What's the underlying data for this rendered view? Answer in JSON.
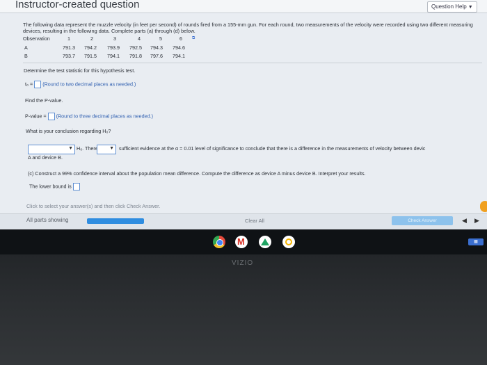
{
  "header": {
    "title": "Instructor-created question",
    "question_help": "Question Help"
  },
  "intro": "The following data represent the muzzle velocity (in feet per second) of rounds fired from a 155-mm gun. For each round, two measurements of the velocity were recorded using two different measuring devices, resulting in the following data. Complete parts (a) through (d) below.",
  "table": {
    "header_label": "Observation",
    "observations": [
      "1",
      "2",
      "3",
      "4",
      "5",
      "6"
    ],
    "rows": [
      {
        "label": "A",
        "values": [
          "791.3",
          "794.2",
          "793.9",
          "792.5",
          "794.3",
          "794.6"
        ]
      },
      {
        "label": "B",
        "values": [
          "793.7",
          "791.5",
          "794.1",
          "791.8",
          "797.6",
          "794.1"
        ]
      }
    ]
  },
  "parts": {
    "test_stat_prompt": "Determine the test statistic for this hypothesis test.",
    "t0_label": "t₀ =",
    "t0_hint": "(Round to two decimal places as needed.)",
    "pvalue_prompt": "Find the P-value.",
    "pvalue_label": "P-value =",
    "pvalue_hint": "(Round to three decimal places as needed.)",
    "conclusion_prompt": "What is your conclusion regarding H₀?",
    "h0_label": "H₀. There",
    "sentence_tail": "sufficient evidence at the α = 0.01 level of significance to conclude that there is a difference in the measurements of velocity between devic",
    "sentence_wrap": "A and device B.",
    "part_c": "(c) Construct a 99% confidence interval about the population mean difference. Compute the difference as device A minus device B. Interpret your results.",
    "lower_bound_label": "The lower bound is"
  },
  "footer": {
    "instruction": "Click to select your answer(s) and then click Check Answer.",
    "all_parts": "All parts showing",
    "progress_fraction": 1.0,
    "clear_all": "Clear All",
    "check_answer": "Check Answer"
  },
  "taskbar": {
    "apps": [
      "chrome-icon",
      "gmail-icon",
      "drive-icon",
      "photos-icon"
    ],
    "gmail_glyph": "M"
  },
  "bezel": {
    "brand": "VIZIO"
  }
}
